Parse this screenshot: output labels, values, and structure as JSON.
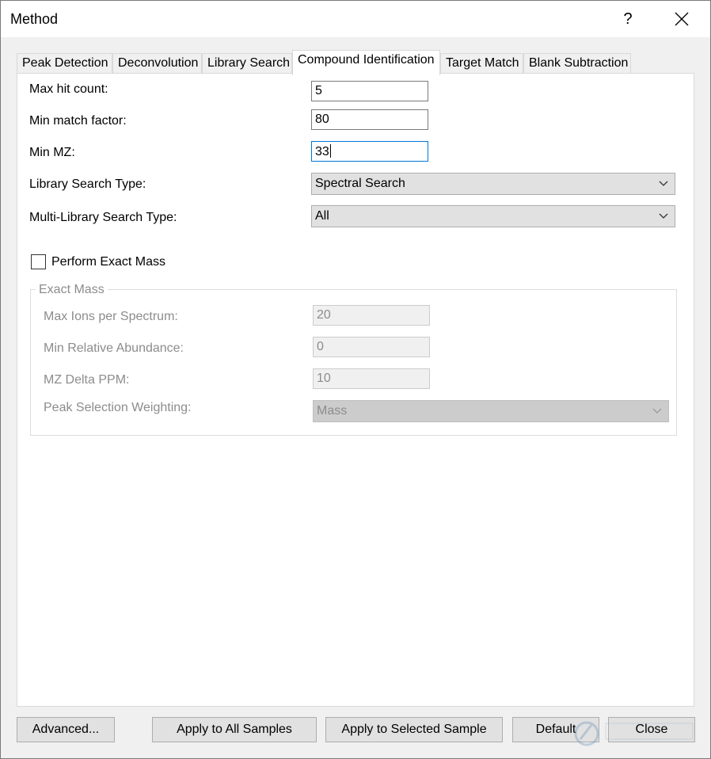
{
  "window": {
    "title": "Method",
    "help_label": "?"
  },
  "tabs": [
    {
      "label": "Peak Detection",
      "active": false
    },
    {
      "label": "Deconvolution",
      "active": false
    },
    {
      "label": "Library Search",
      "active": false
    },
    {
      "label": "Compound Identification",
      "active": true
    },
    {
      "label": "Target Match",
      "active": false
    },
    {
      "label": "Blank Subtraction",
      "active": false
    }
  ],
  "form": {
    "max_hit_count": {
      "label": "Max hit count:",
      "value": "5"
    },
    "min_match_factor": {
      "label": "Min match factor:",
      "value": "80"
    },
    "min_mz": {
      "label": "Min MZ:",
      "value": "33"
    },
    "library_search_type": {
      "label": "Library Search Type:",
      "value": "Spectral Search"
    },
    "multi_library_search_type": {
      "label": "Multi-Library Search Type:",
      "value": "All"
    },
    "perform_exact_mass": {
      "label": "Perform Exact Mass",
      "checked": false
    }
  },
  "exact_mass": {
    "title": "Exact Mass",
    "max_ions_per_spectrum": {
      "label": "Max Ions per Spectrum:",
      "value": "20"
    },
    "min_relative_abundance": {
      "label": "Min Relative Abundance:",
      "value": "0"
    },
    "mz_delta_ppm": {
      "label": "MZ Delta PPM:",
      "value": "10"
    },
    "peak_selection_weighting": {
      "label": "Peak Selection Weighting:",
      "value": "Mass"
    }
  },
  "buttons": {
    "advanced": "Advanced...",
    "apply_all": "Apply to All Samples",
    "apply_selected": "Apply to Selected Sample",
    "default": "Default",
    "close": "Close"
  },
  "colors": {
    "focus_border": "#0078d7",
    "disabled_text": "#8c8c8c",
    "button_face": "#e1e1e1"
  }
}
